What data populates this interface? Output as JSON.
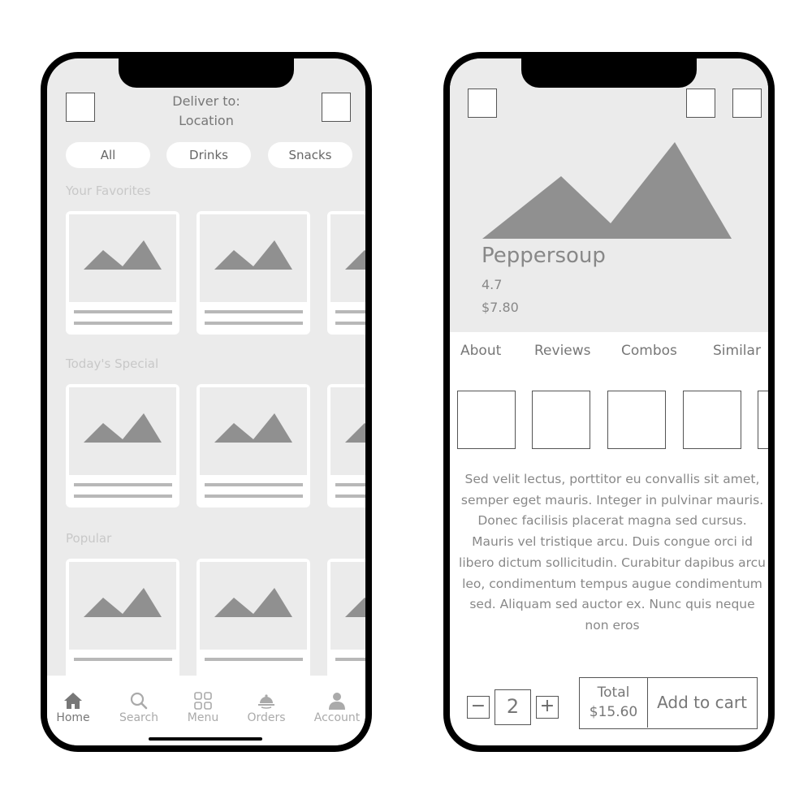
{
  "left_screen": {
    "header": {
      "deliver_label": "Deliver to:",
      "location": "Location"
    },
    "filters": [
      "All",
      "Drinks",
      "Snacks"
    ],
    "sections": [
      {
        "title": "Your Favorites"
      },
      {
        "title": "Today's Special"
      },
      {
        "title": "Popular"
      }
    ],
    "tabbar": [
      {
        "label": "Home",
        "icon": "home-icon",
        "active": true
      },
      {
        "label": "Search",
        "icon": "search-icon",
        "active": false
      },
      {
        "label": "Menu",
        "icon": "menu-grid-icon",
        "active": false
      },
      {
        "label": "Orders",
        "icon": "orders-icon",
        "active": false
      },
      {
        "label": "Account",
        "icon": "account-icon",
        "active": false
      }
    ]
  },
  "right_screen": {
    "product": {
      "name": "Peppersoup",
      "rating": "4.7",
      "price": "$7.80"
    },
    "tabs": [
      "About",
      "Reviews",
      "Combos",
      "Similar"
    ],
    "description": "Sed velit lectus, porttitor eu convallis sit amet, semper eget mauris. Integer in pulvinar mauris. Donec facilisis placerat magna sed cursus. Mauris vel tristique arcu. Duis congue orci id libero dictum sollicitudin. Curabitur dapibus arcu leo, condimentum tempus augue condimentum sed. Aliquam sed auctor ex. Nunc quis neque non eros",
    "quantity": {
      "minus": "−",
      "value": "2",
      "plus": "+"
    },
    "total_label": "Total",
    "total_value": "$15.60",
    "add_to_cart": "Add to cart"
  },
  "colors": {
    "placeholder_bg": "#ebebeb",
    "image_shape": "#909090",
    "text_muted": "#777777",
    "section_label": "#c8c8c8",
    "frame": "#000000"
  }
}
